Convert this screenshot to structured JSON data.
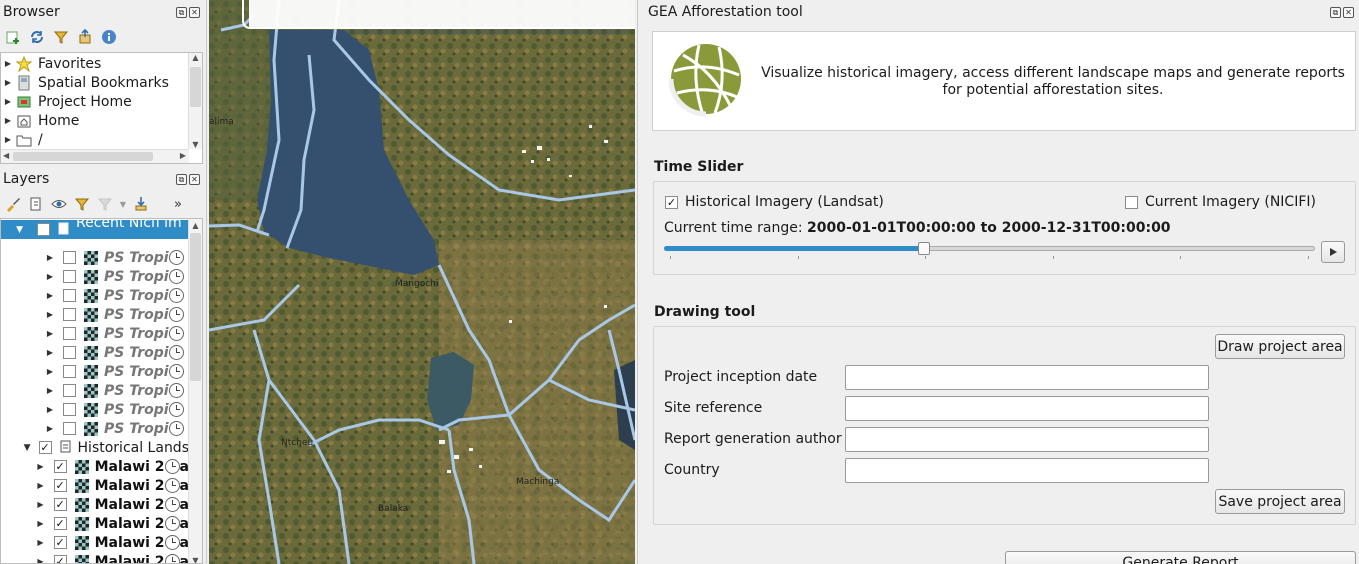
{
  "browser": {
    "title": "Browser",
    "items": [
      {
        "label": "Favorites",
        "icon": "star-icon"
      },
      {
        "label": "Spatial Bookmarks",
        "icon": "bookmark-icon"
      },
      {
        "label": "Project Home",
        "icon": "project-home-icon"
      },
      {
        "label": "Home",
        "icon": "home-icon"
      },
      {
        "label": "/",
        "icon": "folder-icon"
      }
    ]
  },
  "layers": {
    "title": "Layers",
    "group1_label": "Recent Nicfi im",
    "ps_items": [
      "PS Tropi",
      "PS Tropi",
      "PS Tropi",
      "PS Tropi",
      "PS Tropi",
      "PS Tropi",
      "PS Tropi",
      "PS Tropi",
      "PS Tropi",
      "PS Tropi"
    ],
    "group2_label": "Historical Lands",
    "malawi_items": [
      "Malawi 2",
      "Malawi 2",
      "Malawi 2",
      "Malawi 2",
      "Malawi 2",
      "Malawi 2"
    ],
    "malawi_suffix": "a"
  },
  "map": {
    "labels": {
      "salima": "alima",
      "mangochi": "Mangochi",
      "ntcheu": "Ntcheu",
      "machinga": "Machinga",
      "balaka": "Balaka"
    }
  },
  "tool": {
    "title": "GEA Afforestation tool",
    "description": "Visualize historical imagery, access different landscape maps and generate reports for potential afforestation sites.",
    "time_slider": {
      "section_title": "Time Slider",
      "historical_label": "Historical Imagery (Landsat)",
      "historical_checked": true,
      "current_label": "Current Imagery (NICIFI)",
      "current_checked": false,
      "range_prefix": "Current time range:",
      "range_value": "2000-01-01T00:00:00 to 2000-12-31T00:00:00",
      "position": 0.4
    },
    "drawing": {
      "section_title": "Drawing tool",
      "draw_button": "Draw project area",
      "fields": [
        {
          "label": "Project inception date",
          "value": ""
        },
        {
          "label": "Site reference",
          "value": ""
        },
        {
          "label": "Report generation author",
          "value": ""
        },
        {
          "label": "Country",
          "value": ""
        }
      ],
      "save_button": "Save project area"
    },
    "generate_button": "Generate Report"
  },
  "colors": {
    "selection": "#308cc6",
    "logo": "#8a9a3a",
    "lake": "#35506f",
    "border": "#a9c8e8"
  }
}
